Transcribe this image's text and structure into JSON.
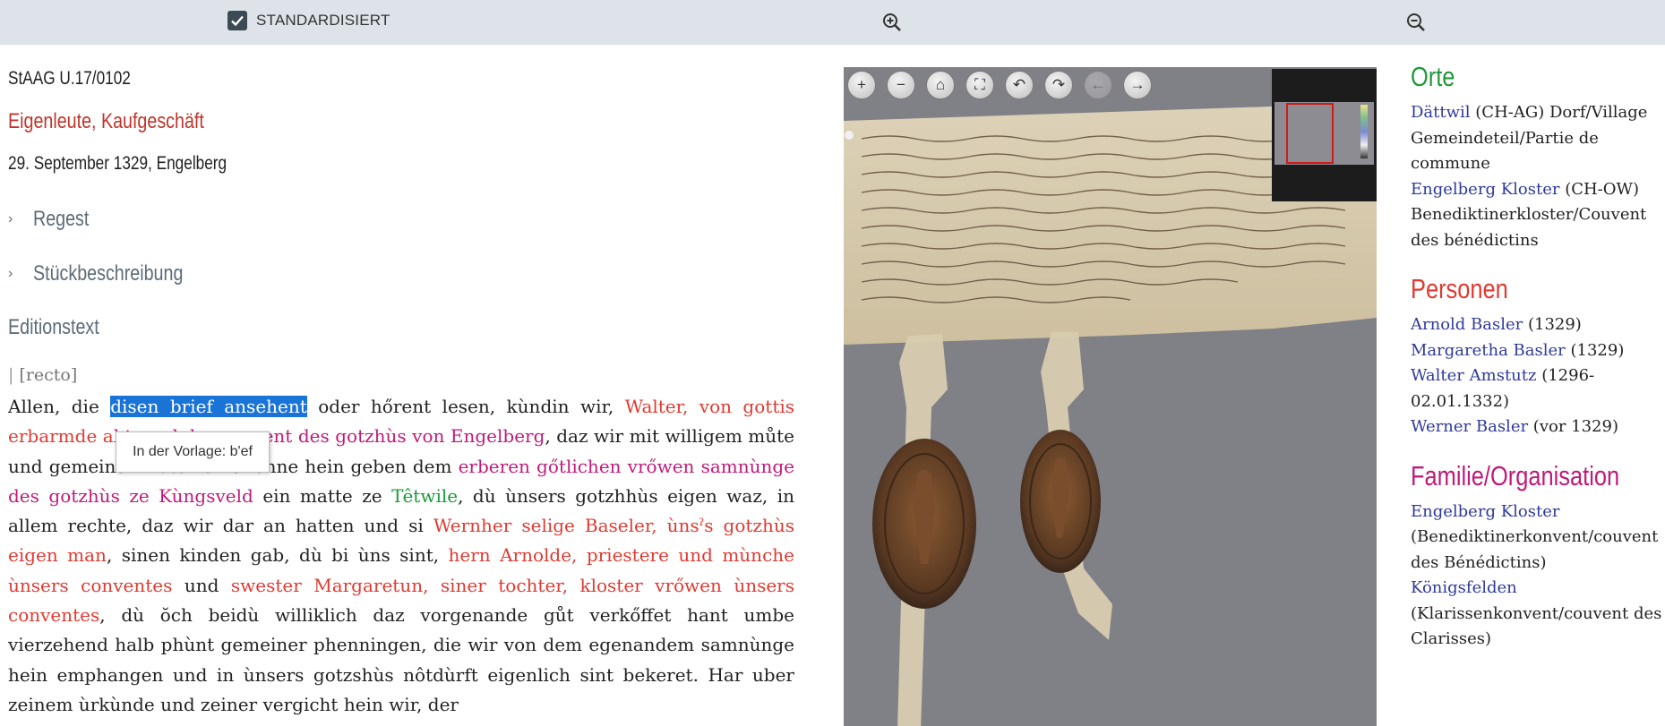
{
  "topbar": {
    "standardized_label": "STANDARDISIERT",
    "standardized_checked": true
  },
  "document": {
    "signature": "StAAG U.17/0102",
    "category": "Eigenleute, Kaufgeschäft",
    "date": "29. September 1329, Engelberg",
    "sections": [
      "Regest",
      "Stückbeschreibung"
    ],
    "edition_heading": "Editionstext",
    "recto": "[recto]",
    "tooltip": "In der Vorlage: b'ef"
  },
  "edition": {
    "s01": "Allen, die ",
    "s02": "disen brief ansehent",
    "s03": " oder hőrent lesen, kùndin wir, ",
    "s04": "Walter, von gottis erbarmde a",
    "s05": "bt, und der convent des gotzhùs von Engelberg",
    "s06": ", daz wir mit willigem můte und gemeinem rate ze kőffenne hein geben dem ",
    "s07": "erberen gőtlichen vrőwen samnùnge des gotzhùs ze Kùngsveld",
    "s08": " ein matte ze ",
    "s09": "Têtwile",
    "s10": ", dù ùnsers gotzhhùs eigen waz, in allem rechte, daz wir dar an hatten und si ",
    "s11": "Wernher selige Baseler, ùnsˀs gotzhùs eigen man",
    "s12": ", sinen kinden gab, dù bi ùns sint, ",
    "s13": "hern Arnolde, priestere und mùnche ùnsers conventes",
    "s14": " und ",
    "s15": "swester Margaretun, siner tochter, kloster vrőwen ùnsers conventes",
    "s16": ", dù ŏch beidù williklich daz vorgenande gůt verkőffet hant umbe vierzehend halb phùnt gemeiner phenningen, die wir von dem egenandem samnùnge hein emphangen und in ùnsers gotzshùs nôtdùrft eigenlich sint bekeret. Har uber zeinem ùrkùnde und zeiner vergicht hein wir, der"
  },
  "viewer": {
    "buttons": [
      {
        "name": "zoom-in",
        "glyph": "+"
      },
      {
        "name": "zoom-out",
        "glyph": "−"
      },
      {
        "name": "home",
        "glyph": "⌂"
      },
      {
        "name": "fullscreen",
        "glyph": "⛶"
      },
      {
        "name": "rotate-left",
        "glyph": "↶"
      },
      {
        "name": "rotate-right",
        "glyph": "↷"
      },
      {
        "name": "previous",
        "glyph": "←"
      },
      {
        "name": "next",
        "glyph": "→"
      }
    ]
  },
  "sidebar": {
    "orte": {
      "title": "Orte",
      "items": [
        {
          "link": "Dättwil",
          "rest": " (CH-AG) Dorf/Village Gemeindeteil/Partie de commune"
        },
        {
          "link": "Engelberg Kloster",
          "rest": " (CH-OW) Benediktinerkloster/Couvent des bénédictins"
        }
      ]
    },
    "personen": {
      "title": "Personen",
      "items": [
        {
          "link": "Arnold Basler",
          "rest": " (1329)"
        },
        {
          "link": "Margaretha Basler",
          "rest": " (1329)"
        },
        {
          "link": "Walter Amstutz",
          "rest": " (1296-02.01.1332)"
        },
        {
          "link": "Werner Basler",
          "rest": " (vor 1329)"
        }
      ]
    },
    "familie": {
      "title": "Familie/Organisation",
      "items": [
        {
          "link": "Engelberg Kloster",
          "rest": " (Benediktinerkonvent/couvent des Bénédictins)"
        },
        {
          "link": "Königsfelden",
          "rest": " (Klarissenkonvent/couvent des Clarisses)"
        }
      ]
    }
  }
}
